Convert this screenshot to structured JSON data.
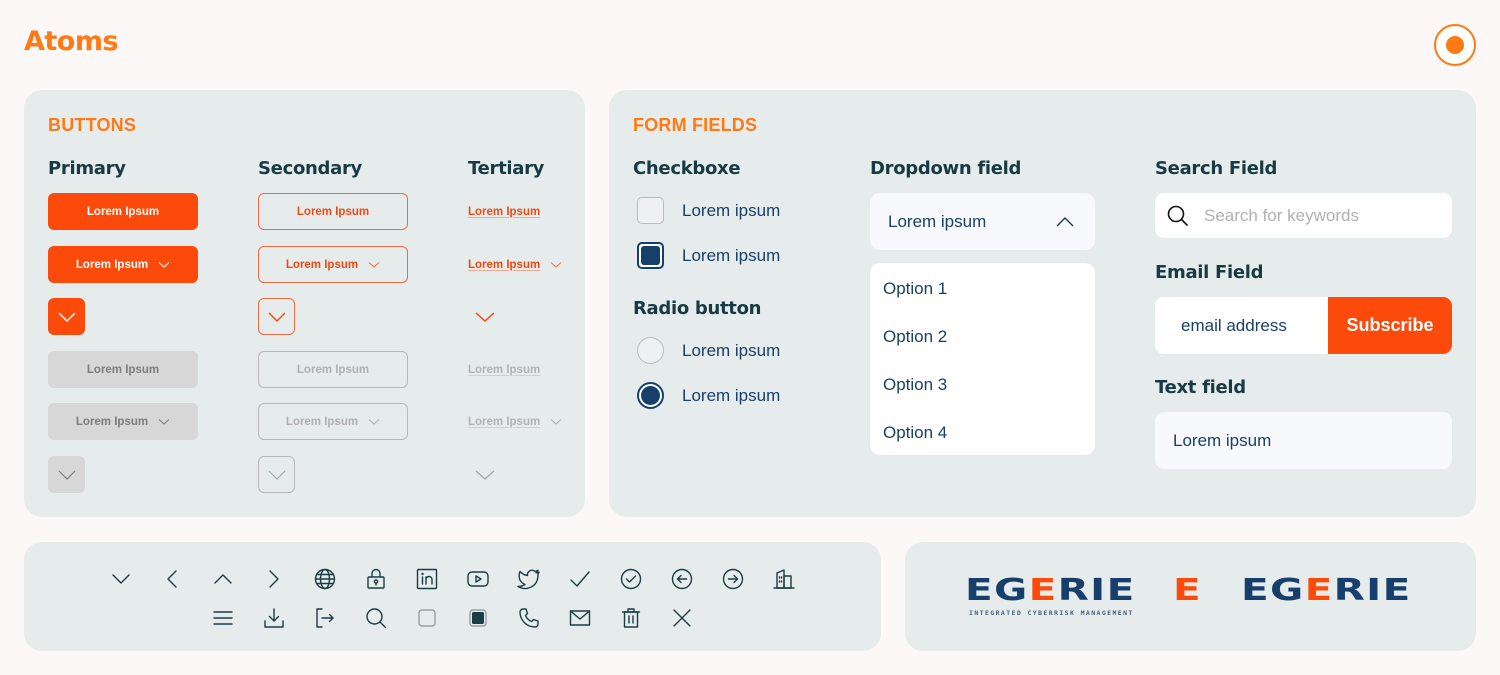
{
  "page": {
    "title": "Atoms",
    "record_icon": "record-icon"
  },
  "buttons": {
    "section_title": "BUTTONS",
    "columns": [
      {
        "title": "Primary"
      },
      {
        "title": "Secondary"
      },
      {
        "title": "Tertiary"
      }
    ],
    "label": "Lorem Ipsum",
    "chevron_icon": "chevron-down-icon"
  },
  "form_fields": {
    "section_title": "FORM FIELDS",
    "checkbox": {
      "title": "Checkboxe",
      "options": [
        {
          "label": "Lorem ipsum",
          "checked": false
        },
        {
          "label": "Lorem ipsum",
          "checked": true
        }
      ]
    },
    "radio": {
      "title": "Radio button",
      "options": [
        {
          "label": "Lorem ipsum",
          "selected": false
        },
        {
          "label": "Lorem ipsum",
          "selected": true
        }
      ]
    },
    "dropdown": {
      "title": "Dropdown field",
      "value": "Lorem ipsum",
      "expanded": true,
      "options": [
        "Option 1",
        "Option 2",
        "Option 3",
        "Option 4"
      ]
    },
    "search": {
      "title": "Search Field",
      "placeholder": "Search for keywords",
      "value": ""
    },
    "email": {
      "title": "Email Field",
      "placeholder": "email address",
      "button_label": "Subscribe"
    },
    "text": {
      "title": "Text field",
      "value": "Lorem ipsum"
    }
  },
  "icons": {
    "row1": [
      "chevron-down",
      "chevron-left",
      "chevron-up",
      "chevron-right",
      "globe",
      "lock",
      "linkedin",
      "youtube",
      "twitter",
      "check",
      "check-circle",
      "arrow-left-circle",
      "arrow-right-circle",
      "building"
    ],
    "row2": [
      "menu",
      "download",
      "logout",
      "search",
      "checkbox-empty",
      "checkbox-filled",
      "phone",
      "mail",
      "trash",
      "close"
    ]
  },
  "logos": {
    "brand_prefix": "EG",
    "brand_accent": "E",
    "brand_suffix": "RIE",
    "tagline": "INTEGRATED CYBERRISK MANAGEMENT",
    "monogram": "E"
  },
  "colors": {
    "accent": "#fc4a0a",
    "title_orange": "#ff7a14",
    "navy": "#163f6b",
    "heading": "#173b44",
    "card_bg": "#e6ebeb",
    "page_bg": "#fcf8f7"
  }
}
